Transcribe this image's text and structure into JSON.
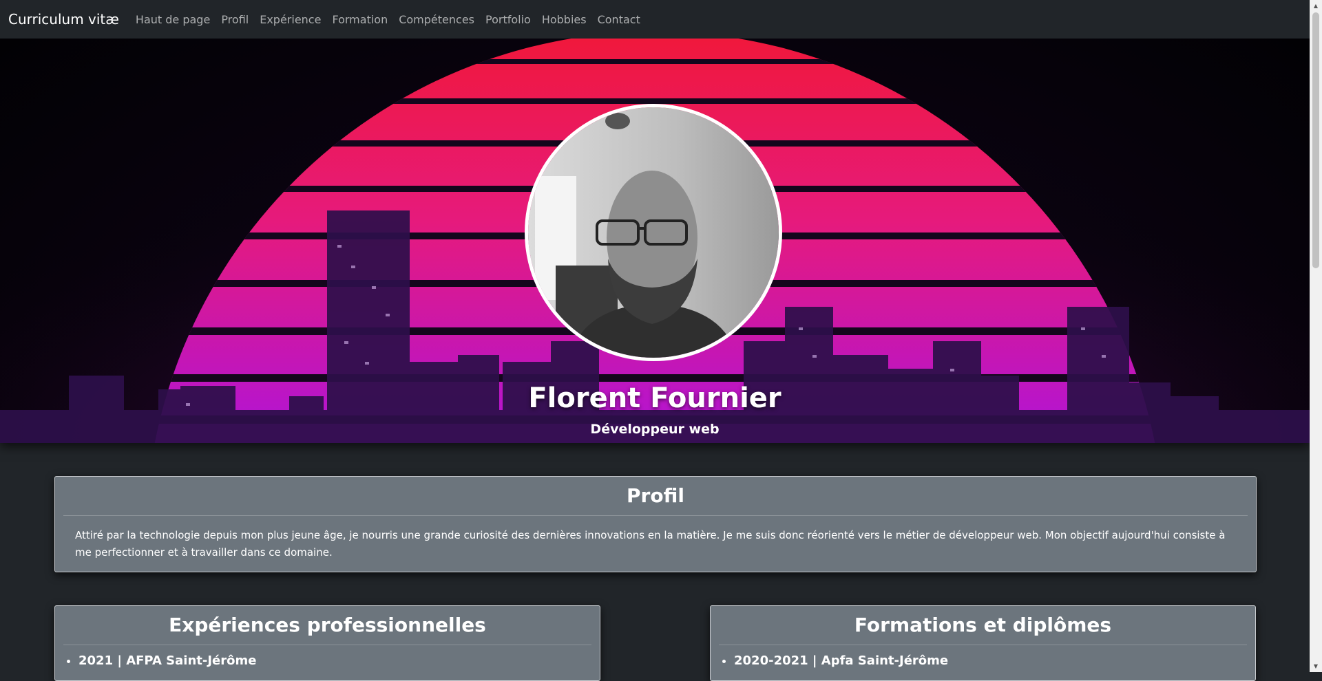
{
  "navbar": {
    "brand": "Curriculum vitæ",
    "links": [
      "Haut de page",
      "Profil",
      "Expérience",
      "Formation",
      "Compétences",
      "Portfolio",
      "Hobbies",
      "Contact"
    ]
  },
  "hero": {
    "name": "Florent Fournier",
    "title": "Développeur web"
  },
  "profil": {
    "heading": "Profil",
    "text": "Attiré par la technologie depuis mon plus jeune âge, je nourris une grande curiosité des dernières innovations en la matière. Je me suis donc réorienté vers le métier de développeur web. Mon objectif aujourd'hui consiste à me perfectionner et à travailler dans ce domaine."
  },
  "experiences": {
    "heading": "Expériences professionnelles",
    "items": [
      "2021 | AFPA Saint-Jérôme"
    ]
  },
  "formations": {
    "heading": "Formations et diplômes",
    "items": [
      "2020-2021 | Apfa Saint-Jérôme"
    ]
  },
  "colors": {
    "background": "#212529",
    "card": "#6c757d",
    "sun_top": "#f0183c",
    "sun_bottom": "#b014d8"
  }
}
